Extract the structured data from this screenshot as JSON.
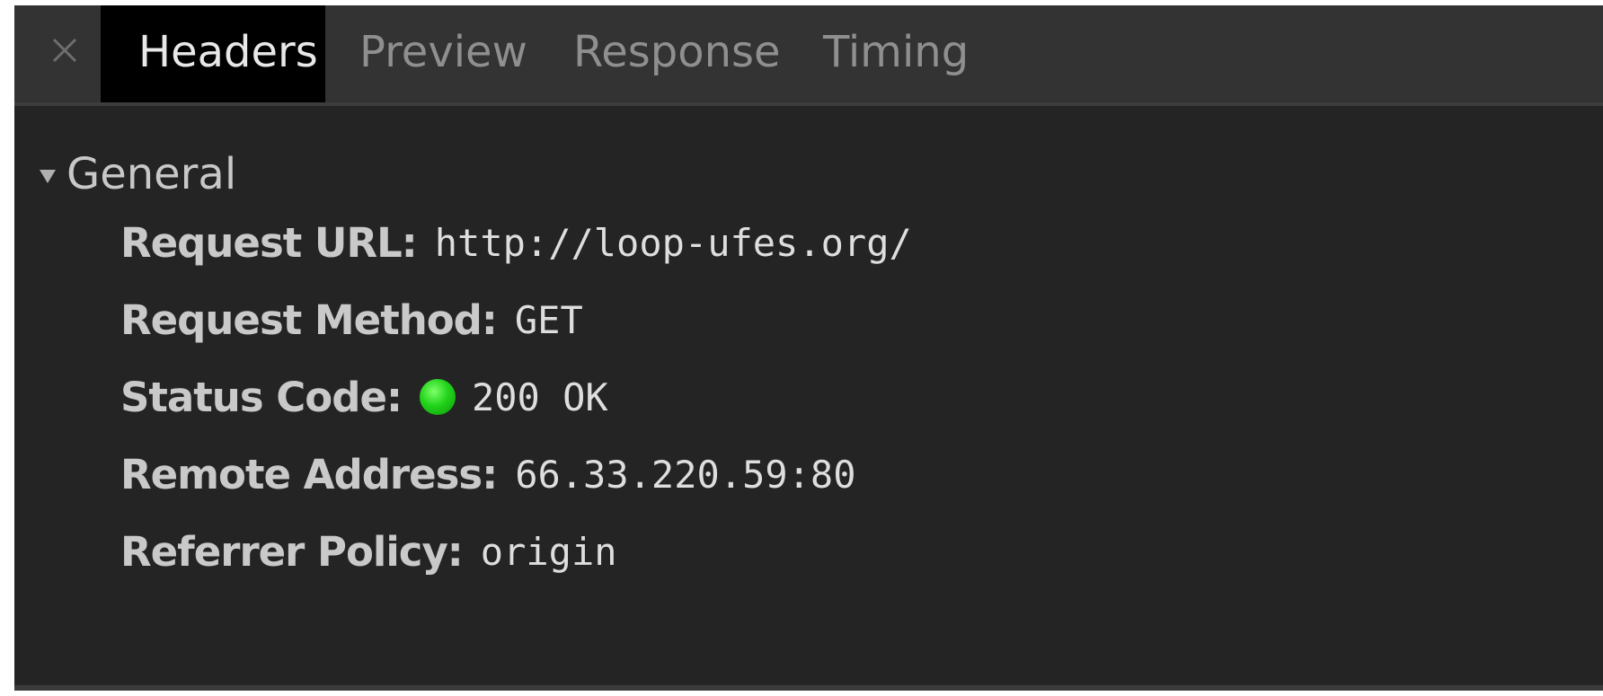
{
  "tabs": [
    {
      "label": "Headers",
      "active": true
    },
    {
      "label": "Preview",
      "active": false
    },
    {
      "label": "Response",
      "active": false
    },
    {
      "label": "Timing",
      "active": false
    }
  ],
  "icons": {
    "close": "close-icon",
    "expand": "triangle-down-icon",
    "status": "green-dot-icon"
  },
  "general": {
    "title": "General",
    "rows": [
      {
        "label": "Request URL:",
        "value": "http://loop-ufes.org/"
      },
      {
        "label": "Request Method:",
        "value": "GET"
      },
      {
        "label": "Status Code:",
        "value": "200 OK"
      },
      {
        "label": "Remote Address:",
        "value": "66.33.220.59:80"
      },
      {
        "label": "Referrer Policy:",
        "value": "origin"
      }
    ]
  },
  "colors": {
    "panel_background": "#242424",
    "tabbar_background": "#333333",
    "active_tab_background": "#000000",
    "status_ok": "#22d41a"
  }
}
